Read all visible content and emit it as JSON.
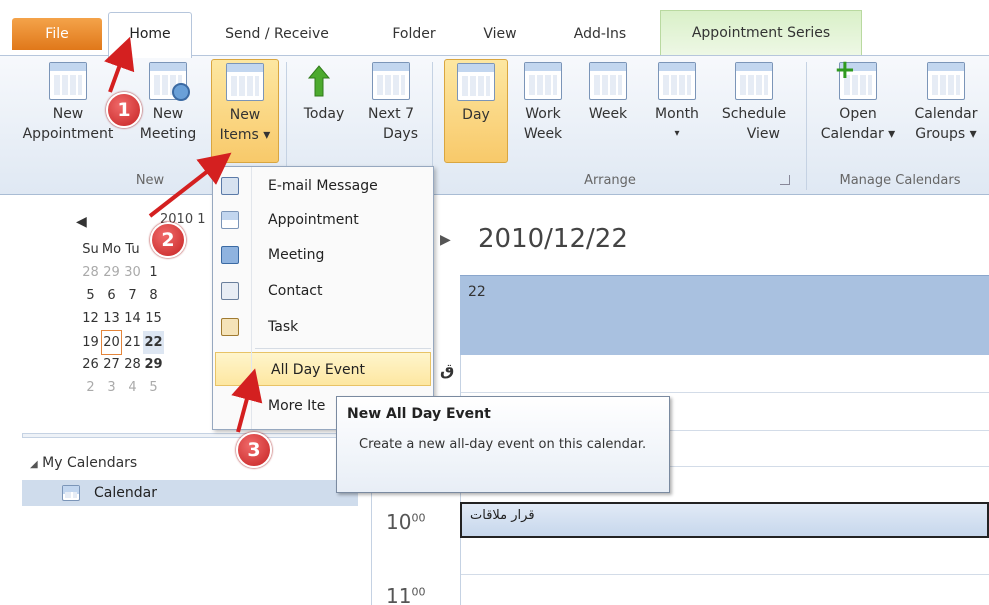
{
  "tabs": {
    "file": "File",
    "home": "Home",
    "send_receive": "Send / Receive",
    "folder": "Folder",
    "view": "View",
    "add_ins": "Add-Ins",
    "appointment_series": "Appointment Series"
  },
  "ribbon": {
    "new_appointment": [
      "New",
      "Appointment"
    ],
    "new_meeting": [
      "New",
      "Meeting"
    ],
    "new_items": [
      "New",
      "Items ▾"
    ],
    "today": [
      "Today",
      ""
    ],
    "next7": [
      "Next 7",
      "Days"
    ],
    "day": [
      "Day",
      ""
    ],
    "work_week": [
      "Work",
      "Week"
    ],
    "week": [
      "Week",
      ""
    ],
    "month": [
      "Month",
      "▾"
    ],
    "schedule_view": [
      "Schedule",
      "View"
    ],
    "open_calendar": [
      "Open",
      "Calendar ▾"
    ],
    "calendar_groups": [
      "Calendar",
      "Groups ▾"
    ],
    "groups": {
      "new": "New",
      "arrange": "Arrange",
      "manage": "Manage Calendars"
    }
  },
  "mini_calendar": {
    "month_label": "2010 1",
    "header": [
      "Su",
      "Mo",
      "Tu"
    ],
    "rows": [
      [
        "28",
        "29",
        "30",
        "1"
      ],
      [
        "5",
        "6",
        "7",
        "8"
      ],
      [
        "12",
        "13",
        "14",
        "15"
      ],
      [
        "19",
        "20",
        "21",
        "22"
      ],
      [
        "26",
        "27",
        "28",
        "29"
      ],
      [
        "2",
        "3",
        "4",
        "5"
      ]
    ]
  },
  "nav": {
    "my_calendars": "My Calendars",
    "calendar": "Calendar"
  },
  "main": {
    "date_header": "2010/12/22",
    "day_number": "22",
    "truncated_label": "ق",
    "hour_10": "10",
    "hour_11": "11",
    "minutes": "00",
    "appointment": "قرار ملاقات"
  },
  "menu": {
    "email": "E-mail Message",
    "appointment": "Appointment",
    "meeting": "Meeting",
    "contact": "Contact",
    "task": "Task",
    "all_day_event": "All Day Event",
    "more_items": "More Ite"
  },
  "tooltip": {
    "title": "New All Day Event",
    "description": "Create a new all-day event on this calendar."
  },
  "badges": [
    "1",
    "2",
    "3"
  ],
  "colors": {
    "accent_red": "#cc2a2a",
    "file_tab": "#e8852a",
    "highlight": "#fde7a1",
    "day_block": "#a9c1e0"
  }
}
